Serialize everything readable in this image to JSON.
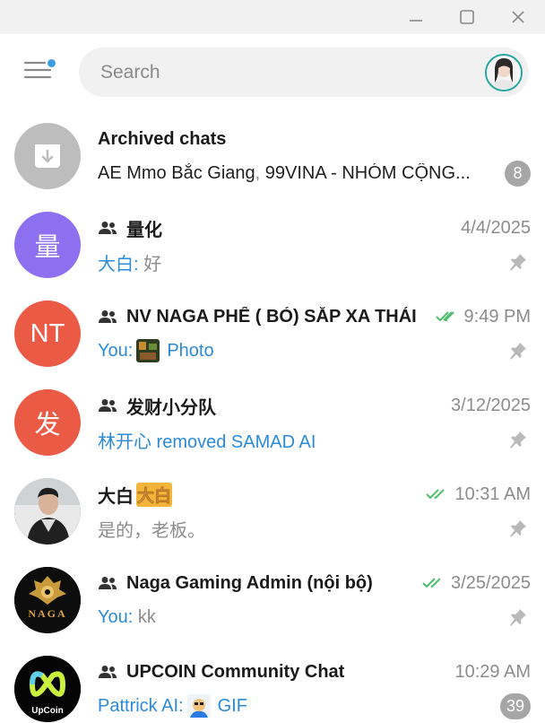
{
  "search": {
    "placeholder": "Search"
  },
  "chats": [
    {
      "name": "Archived chats",
      "preview_names": "AE Mmo Bắc Giang",
      "preview_sep": ", ",
      "preview_rest": "99VINA - NHÓM CỘNG...",
      "badge": "8"
    },
    {
      "name": "量化",
      "avatar_text": "量",
      "avatar_color": "#8d6ff0",
      "time": "4/4/2025",
      "sender": "大白:",
      "message": " 好",
      "group": true,
      "pinned": true
    },
    {
      "name": "NV NAGA PHẾ ( BỎ) SẮP XA THẢI",
      "avatar_text": "NT",
      "avatar_color": "#ea5a45",
      "time": "9:49 PM",
      "sender": "You:",
      "message": "Photo",
      "group": true,
      "pinned": true,
      "read": true
    },
    {
      "name": "发财小分队",
      "avatar_text": "发",
      "avatar_color": "#ea5a45",
      "time": "3/12/2025",
      "message": "林开心 removed SAMAD AI",
      "group": true,
      "pinned": true
    },
    {
      "name": "大白",
      "emoji_text": "大白",
      "time": "10:31 AM",
      "message": "是的，老板。",
      "group": false,
      "pinned": true,
      "read": true
    },
    {
      "name": "Naga Gaming Admin (nội bộ)",
      "logo_text": "NAGA",
      "time": "3/25/2025",
      "sender": "You:",
      "message": " kk",
      "group": true,
      "pinned": true,
      "read": true
    },
    {
      "name": "UPCOIN Community Chat",
      "logo_text": "UpCoin",
      "time": "10:29 AM",
      "sender": "Pattrick AI:",
      "message": "GIF",
      "group": true,
      "badge": "39"
    }
  ],
  "colors": {
    "accent": "#2b8bd8",
    "read_check": "#4fbf6b",
    "badge": "#a6a6a6"
  }
}
